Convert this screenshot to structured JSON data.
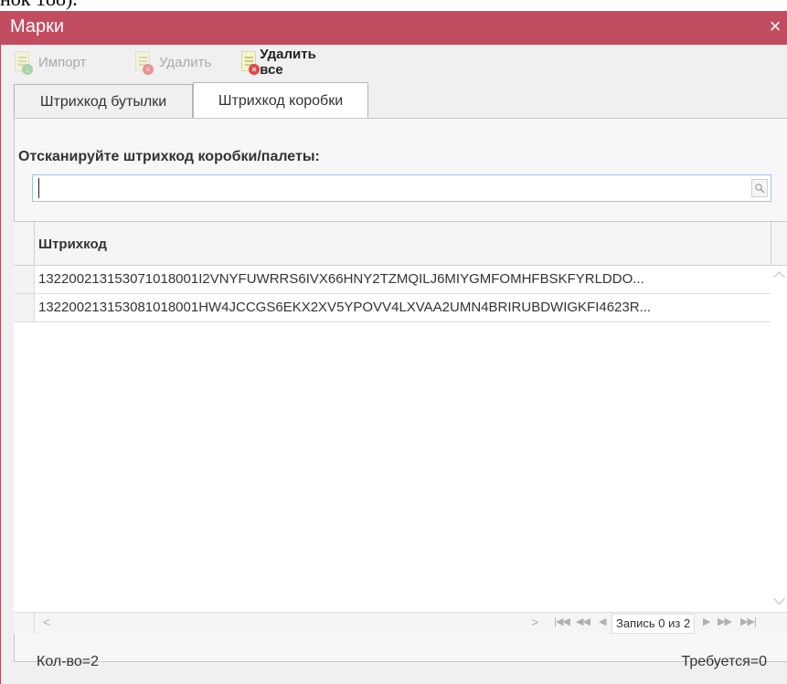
{
  "background_text": "нок 188).",
  "window": {
    "title": "Марки",
    "close_symbol": "×"
  },
  "toolbar": {
    "import_label": "Импорт",
    "delete_label": "Удалить",
    "delete_all_label": "Удалить все"
  },
  "tabs": [
    {
      "label": "Штрихкод бутылки",
      "active": false
    },
    {
      "label": "Штрихкод коробки",
      "active": true
    }
  ],
  "scan": {
    "label": "Отсканируйте штрихкод коробки/палеты:",
    "value": "",
    "placeholder": ""
  },
  "grid": {
    "columns": [
      "Штрихкод"
    ],
    "rows": [
      "132200213153071018001I2VNYFUWRRS6IVX66HNY2TZMQILJ6MIYGMFOMHFBSKFYRLDDO...",
      "132200213153081018001HW4JCCGS6EKX2XV5YPOVV4LXVAA2UMN4BRIRUBDWIGKFI4623R..."
    ]
  },
  "pager": {
    "record_text": "Запись 0 из 2"
  },
  "footer": {
    "count": "Кол-во=2",
    "required": "Требуется=0"
  },
  "colors": {
    "titlebar": "#c24d60",
    "input_border": "#9fc2e6",
    "delete_badge": "#e2464a"
  }
}
